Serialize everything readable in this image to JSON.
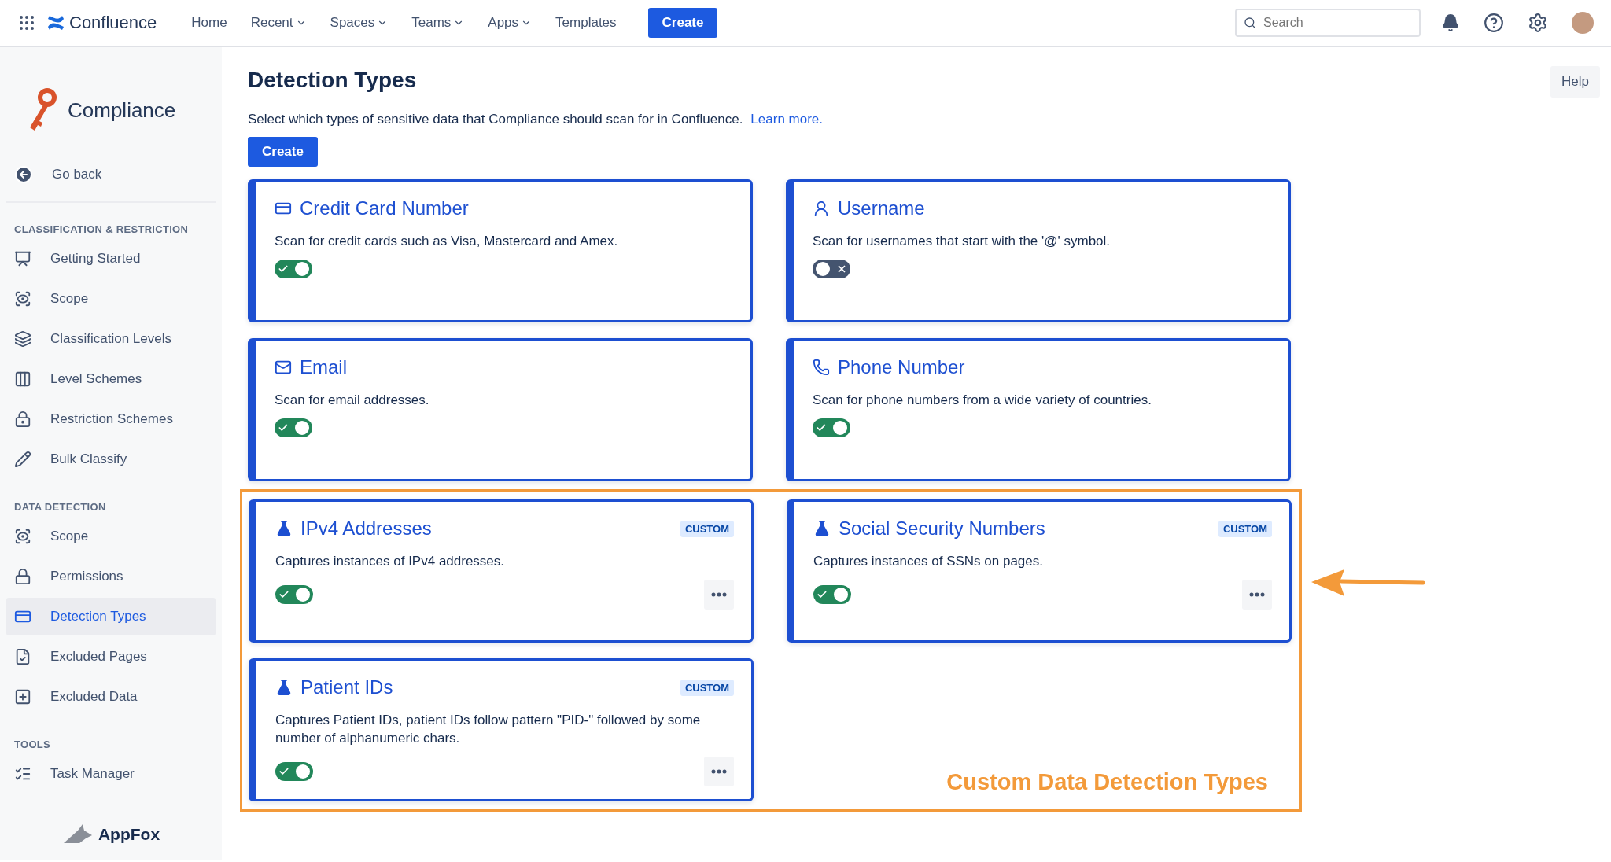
{
  "topbar": {
    "product": "Confluence",
    "nav": [
      {
        "label": "Home",
        "dropdown": false
      },
      {
        "label": "Recent",
        "dropdown": true
      },
      {
        "label": "Spaces",
        "dropdown": true
      },
      {
        "label": "Teams",
        "dropdown": true
      },
      {
        "label": "Apps",
        "dropdown": true
      },
      {
        "label": "Templates",
        "dropdown": false
      }
    ],
    "create": "Create",
    "search": {
      "placeholder": "Search"
    }
  },
  "sidebar": {
    "app": "Compliance",
    "back": "Go back",
    "sections": [
      {
        "title": "CLASSIFICATION & RESTRICTION",
        "items": [
          {
            "label": "Getting Started",
            "selected": false
          },
          {
            "label": "Scope",
            "selected": false
          },
          {
            "label": "Classification Levels",
            "selected": false
          },
          {
            "label": "Level Schemes",
            "selected": false
          },
          {
            "label": "Restriction Schemes",
            "selected": false
          },
          {
            "label": "Bulk Classify",
            "selected": false
          }
        ]
      },
      {
        "title": "DATA DETECTION",
        "items": [
          {
            "label": "Scope",
            "selected": false
          },
          {
            "label": "Permissions",
            "selected": false
          },
          {
            "label": "Detection Types",
            "selected": true
          },
          {
            "label": "Excluded Pages",
            "selected": false
          },
          {
            "label": "Excluded Data",
            "selected": false
          }
        ]
      },
      {
        "title": "TOOLS",
        "items": [
          {
            "label": "Task Manager",
            "selected": false
          }
        ]
      }
    ],
    "vendor": "AppFox"
  },
  "page": {
    "title": "Detection Types",
    "description": "Select which types of sensitive data that Compliance should scan for in Confluence.",
    "link": "Learn more.",
    "create": "Create",
    "help": "Help"
  },
  "cards": [
    {
      "title": "Credit Card Number",
      "description": "Scan for credit cards such as Visa, Mastercard and Amex.",
      "on": true,
      "custom": false
    },
    {
      "title": "Username",
      "description": "Scan for usernames that start with the '@' symbol.",
      "on": false,
      "custom": false
    },
    {
      "title": "Email",
      "description": "Scan for email addresses.",
      "on": true,
      "custom": false
    },
    {
      "title": "Phone Number",
      "description": "Scan for phone numbers from a wide variety of countries.",
      "on": true,
      "custom": false
    },
    {
      "title": "IPv4 Addresses",
      "description": "Captures instances of IPv4 addresses.",
      "on": true,
      "custom": true,
      "badge": "CUSTOM"
    },
    {
      "title": "Social Security Numbers",
      "description": "Captures instances of SSNs on pages.",
      "on": true,
      "custom": true,
      "badge": "CUSTOM"
    },
    {
      "title": "Patient IDs",
      "description": "Captures Patient IDs, patient IDs follow pattern \"PID-\" followed by some number of alphanumeric chars.",
      "on": true,
      "custom": true,
      "badge": "CUSTOM"
    }
  ],
  "annotation": {
    "label": "Custom Data Detection Types"
  }
}
